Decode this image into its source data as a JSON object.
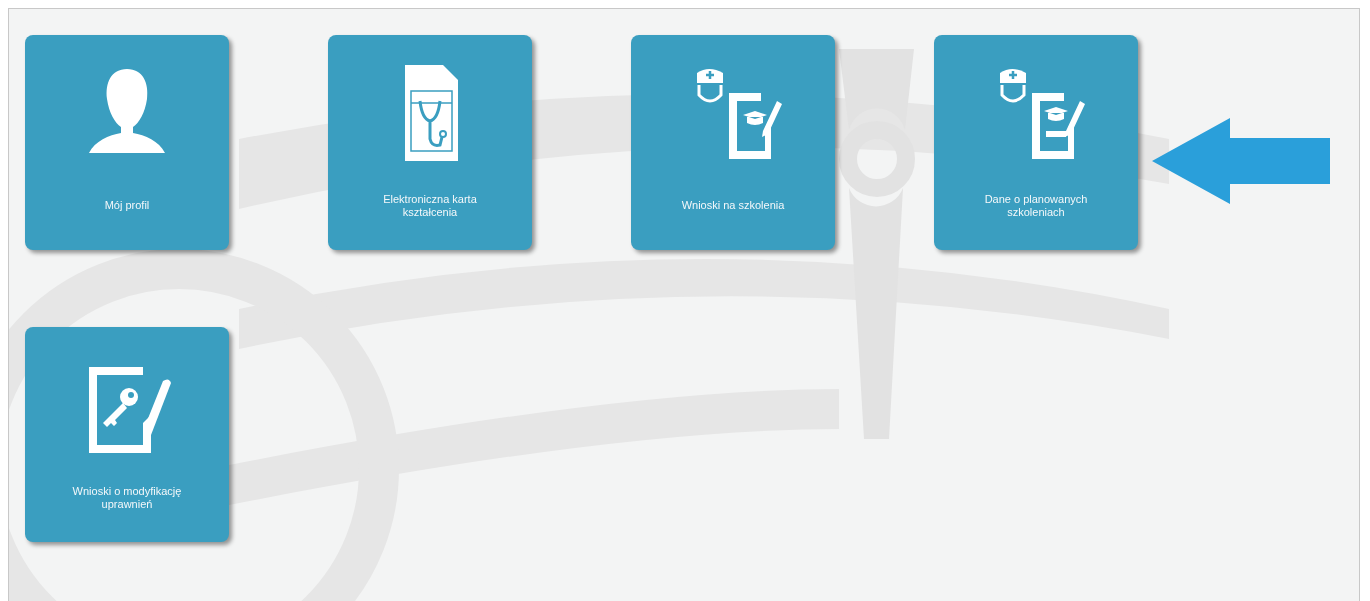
{
  "tiles": [
    {
      "label": "Mój profil",
      "kind": "person"
    },
    {
      "label": "Elektroniczna karta kształcenia",
      "kind": "card"
    },
    {
      "label": "Wnioski na szkolenia",
      "kind": "request"
    },
    {
      "label": "Dane o planowanych szkoleniach",
      "kind": "plan"
    },
    {
      "label": "Wnioski o modyfikację uprawnień",
      "kind": "permission"
    }
  ]
}
